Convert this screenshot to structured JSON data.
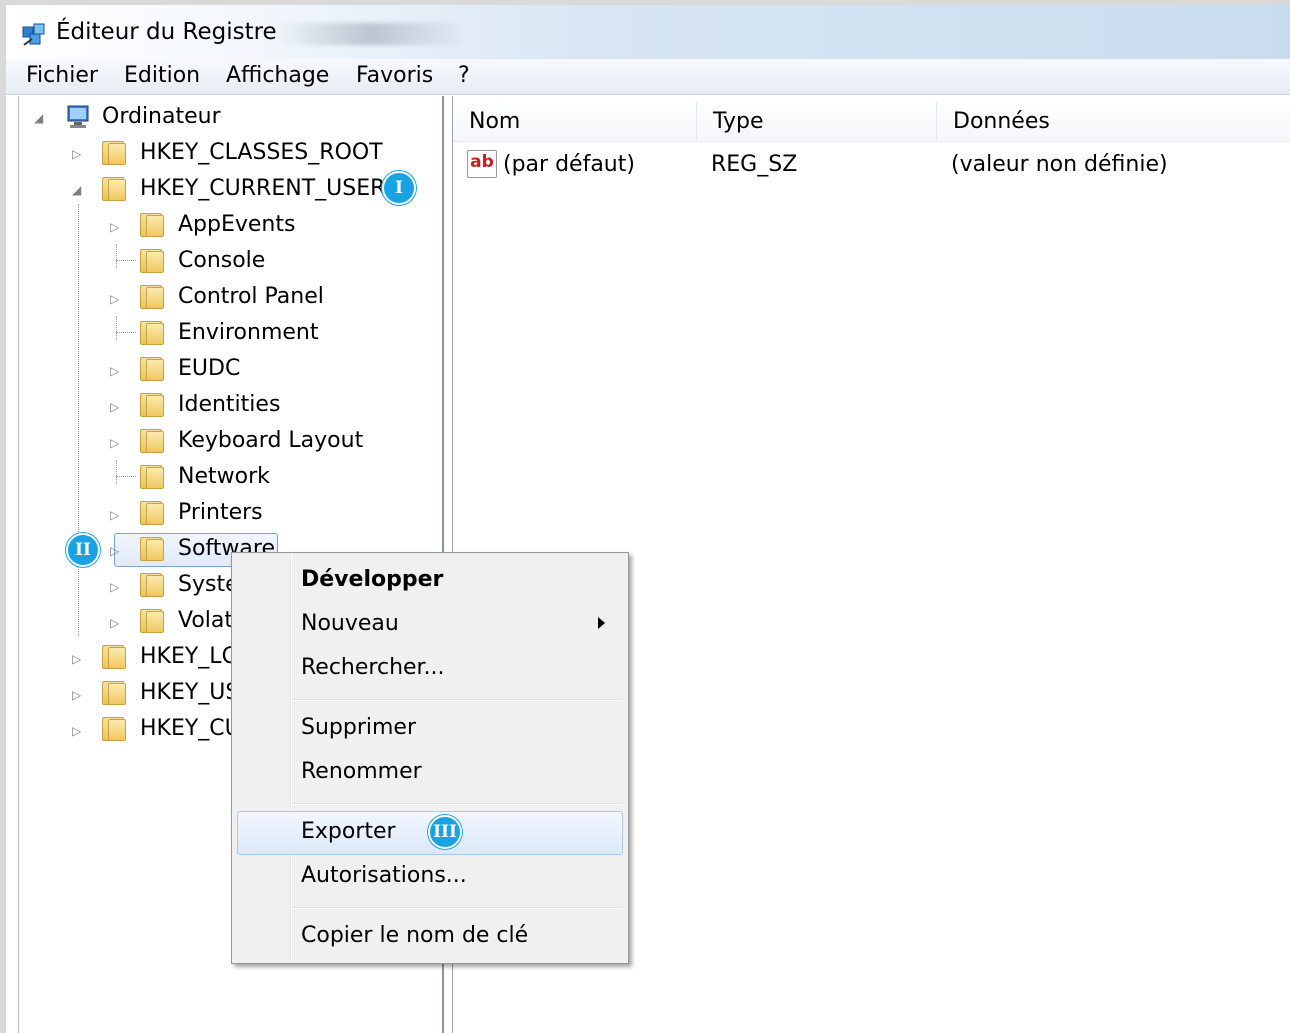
{
  "window": {
    "title": "Éditeur du Registre"
  },
  "menu": [
    "Fichier",
    "Edition",
    "Affichage",
    "Favoris",
    "?"
  ],
  "tree": {
    "root": "Ordinateur",
    "hives_top": [
      "HKEY_CLASSES_ROOT",
      "HKEY_CURRENT_USER"
    ],
    "current_user_children": [
      "AppEvents",
      "Console",
      "Control Panel",
      "Environment",
      "EUDC",
      "Identities",
      "Keyboard Layout",
      "Network",
      "Printers",
      "Software",
      "Syste",
      "Volat"
    ],
    "hives_bottom": [
      "HKEY_LC",
      "HKEY_US",
      "HKEY_CU"
    ]
  },
  "values": {
    "columns": [
      "Nom",
      "Type",
      "Données"
    ],
    "rows": [
      {
        "name": "(par défaut)",
        "type": "REG_SZ",
        "data": "(valeur non définie)",
        "icon": "ab-string-icon"
      }
    ]
  },
  "context_menu": {
    "items": [
      "Développer",
      "Nouveau",
      "Rechercher...",
      "Supprimer",
      "Renommer",
      "Exporter",
      "Autorisations...",
      "Copier le nom de clé"
    ],
    "bold_item": "Développer",
    "highlighted_item": "Exporter"
  },
  "badges": [
    "I",
    "II",
    "III"
  ],
  "colors": {
    "badge": "#1aa3e2",
    "selection_border": "#7da2ce",
    "titlebar_blue": "#c9dcef"
  }
}
